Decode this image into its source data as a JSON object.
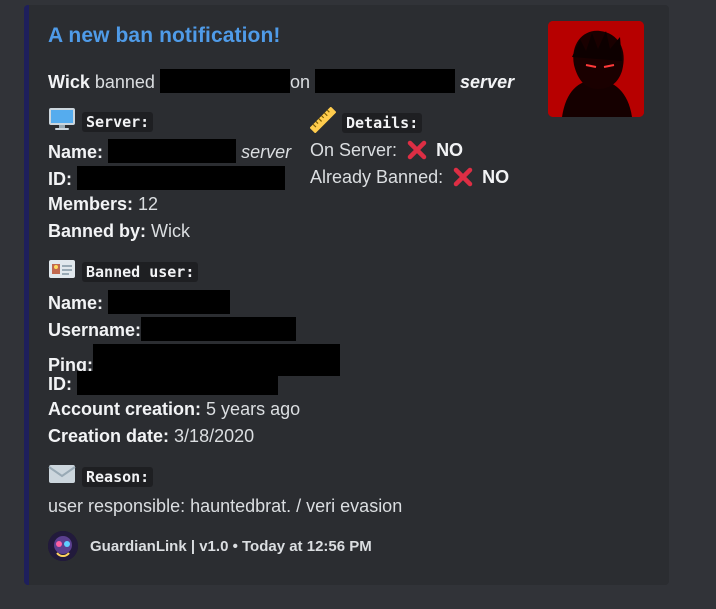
{
  "embed": {
    "title": "A new ban notification!",
    "summary": {
      "actor": "Wick",
      "verb": "banned",
      "connector": "on",
      "suffix": "server"
    },
    "server_section": {
      "icon": "desktop-computer-icon",
      "heading": "Server:",
      "name_label": "Name:",
      "name_suffix": "server",
      "id_label": "ID:",
      "members_label": "Members:",
      "members_value": "12",
      "banned_by_label": "Banned by:",
      "banned_by_value": "Wick"
    },
    "details_section": {
      "icon": "ruler-icon",
      "heading": "Details:",
      "on_server_label": "On Server:",
      "on_server_value": "NO",
      "already_banned_label": "Already Banned:",
      "already_banned_value": "NO",
      "cross_icon": "cross-mark-icon"
    },
    "banned_user_section": {
      "icon": "id-card-icon",
      "heading": "Banned user:",
      "name_label": "Name:",
      "username_label": "Username:",
      "ping_label": "Ping:",
      "id_label": "ID:",
      "account_creation_label": "Account creation:",
      "account_creation_value": "5 years ago",
      "creation_date_label": "Creation date:",
      "creation_date_value": "3/18/2020"
    },
    "reason_section": {
      "icon": "envelope-icon",
      "heading": "Reason:",
      "text": "user responsible: hauntedbrat. / veri evasion"
    },
    "footer": {
      "text": "GuardianLink | v1.0 • Today at 12:56 PM"
    },
    "colors": {
      "title": "#4f9be8",
      "accent_bar": "#1e1f5c",
      "cross": "#dd2e44",
      "thumbnail_bg": "#b70000"
    }
  }
}
